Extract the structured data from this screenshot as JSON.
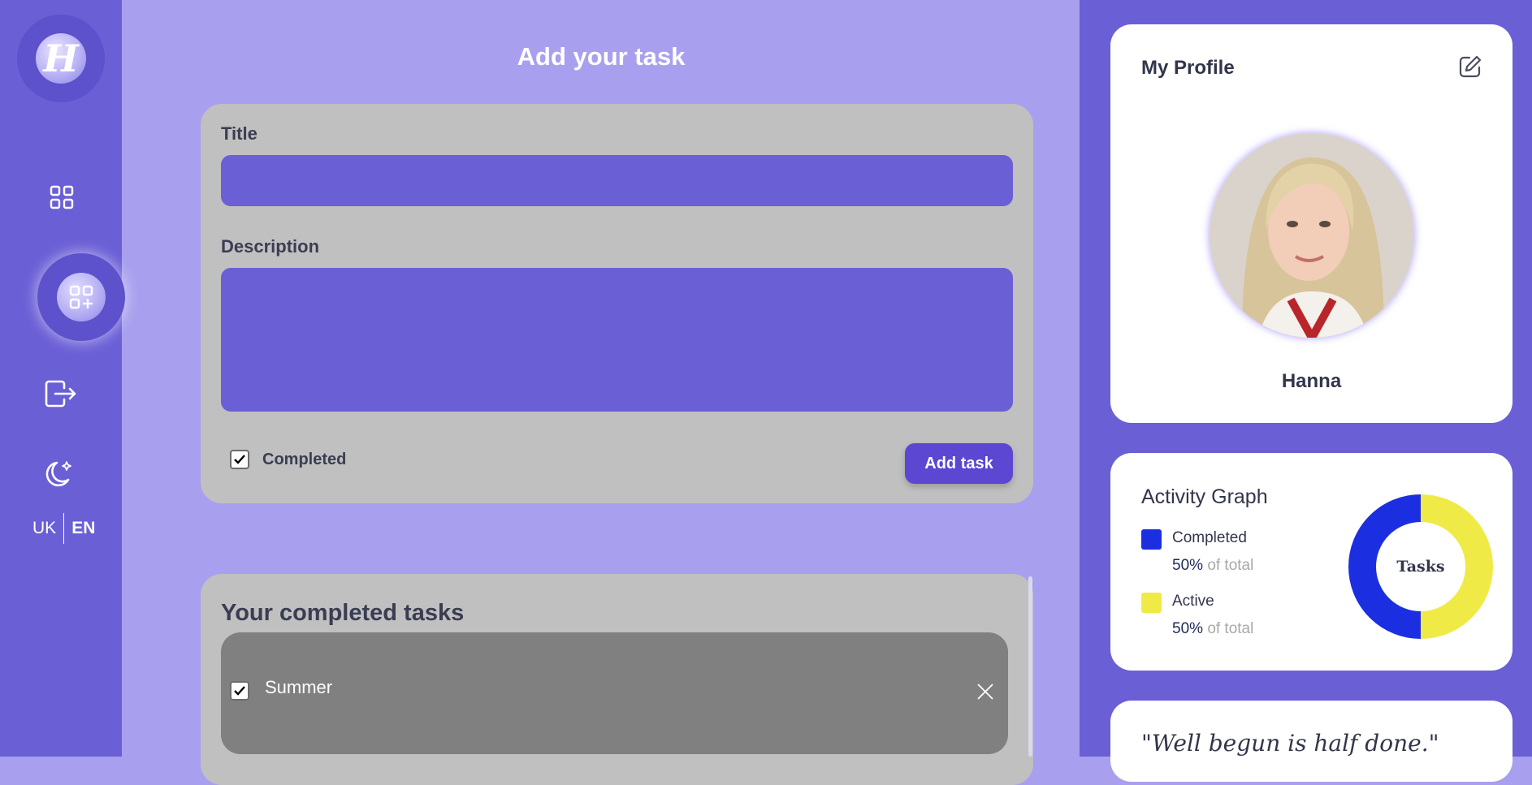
{
  "sidebar": {
    "logo_letter": "H",
    "lang": {
      "uk": "UK",
      "en": "EN",
      "active": "EN"
    }
  },
  "main": {
    "title": "Add your task",
    "form": {
      "title_label": "Title",
      "title_value": "",
      "description_label": "Description",
      "description_value": "",
      "completed_label": "Completed",
      "completed_checked": true,
      "add_button": "Add task"
    },
    "completed_tasks": {
      "title": "Your completed tasks",
      "items": [
        {
          "title": "Summer",
          "completed": true
        }
      ]
    }
  },
  "profile": {
    "title": "My Profile",
    "name": "Hanna"
  },
  "activity": {
    "title": "Activity Graph",
    "center_label": "Tasks",
    "items": [
      {
        "name": "Completed",
        "percent": "50%",
        "suffix": "of total",
        "color": "#1c2fe0"
      },
      {
        "name": "Active",
        "percent": "50%",
        "suffix": "of total",
        "color": "#f0ea46"
      }
    ]
  },
  "quote": {
    "text": "\"Well begun is half done.\""
  },
  "colors": {
    "sidebar_bg": "#6b5fd6",
    "main_bg": "#a8a0ee",
    "card_bg": "#c0c0c0",
    "input_bg": "#6b5fd6",
    "button_bg": "#5b47d1",
    "task_item_bg": "#808080"
  }
}
